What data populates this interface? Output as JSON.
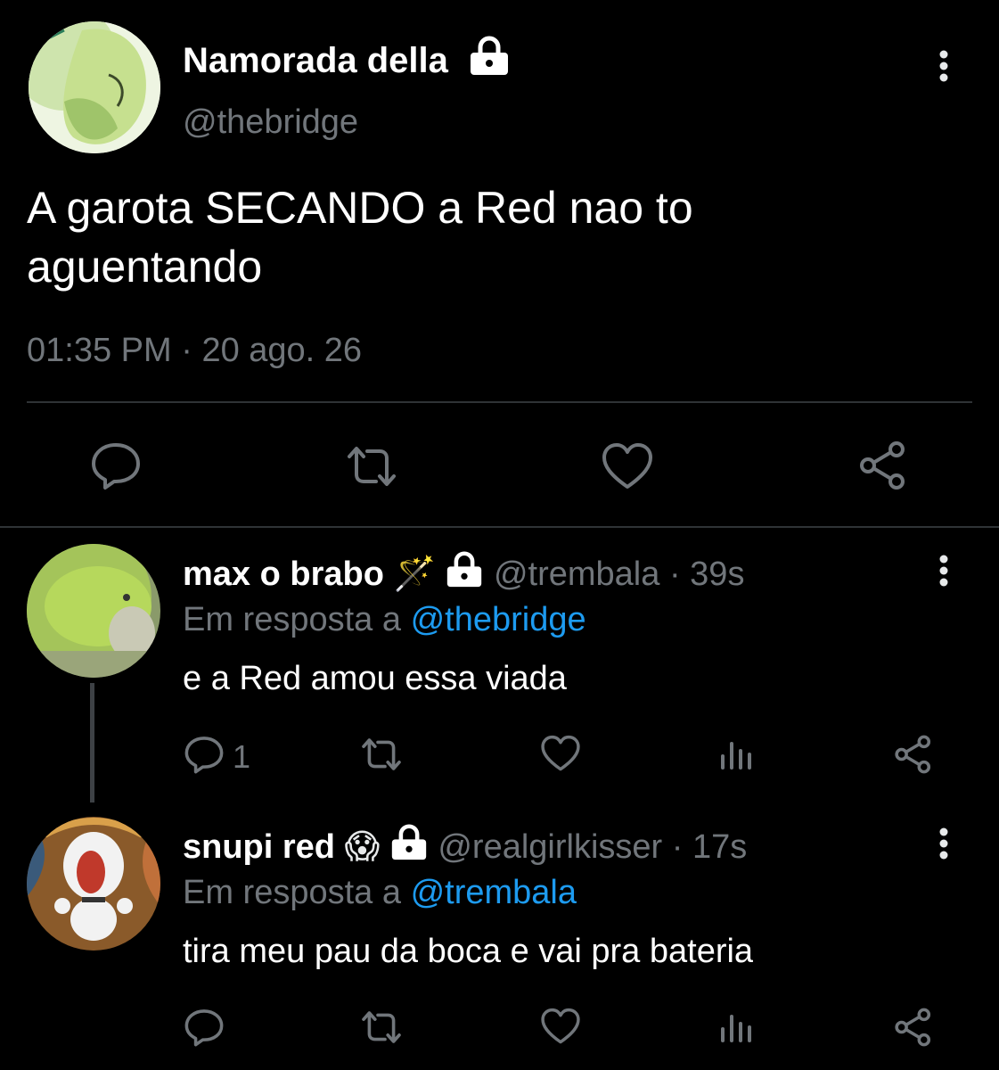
{
  "main_tweet": {
    "display_name": "Namorada della",
    "handle": "@thebridge",
    "text": "A garota SECANDO a Red nao to aguentando",
    "time": "01:35 PM",
    "separator": "·",
    "date": "20 ago. 26"
  },
  "replies": [
    {
      "display_name": "max o brabo",
      "emoji": "🪄",
      "handle": "@trembala",
      "separator": "·",
      "age": "39s",
      "reply_prefix": "Em resposta a",
      "reply_to": "@thebridge",
      "text": "e a Red amou essa viada",
      "reply_count": "1"
    },
    {
      "display_name": "snupi red",
      "emoji": "😱",
      "handle": "@realgirlkisser",
      "separator": "·",
      "age": "17s",
      "reply_prefix": "Em resposta a",
      "reply_to": "@trembala",
      "text": "tira meu pau da boca e vai pra bateria",
      "reply_count": ""
    }
  ],
  "icons": [
    "lock-icon",
    "more-icon",
    "reply-icon",
    "retweet-icon",
    "like-icon",
    "share-icon",
    "views-icon"
  ],
  "colors": {
    "background": "#000000",
    "text": "#e7e9ea",
    "muted": "#71767b",
    "link": "#1d9bf0",
    "divider": "#2f3336"
  }
}
